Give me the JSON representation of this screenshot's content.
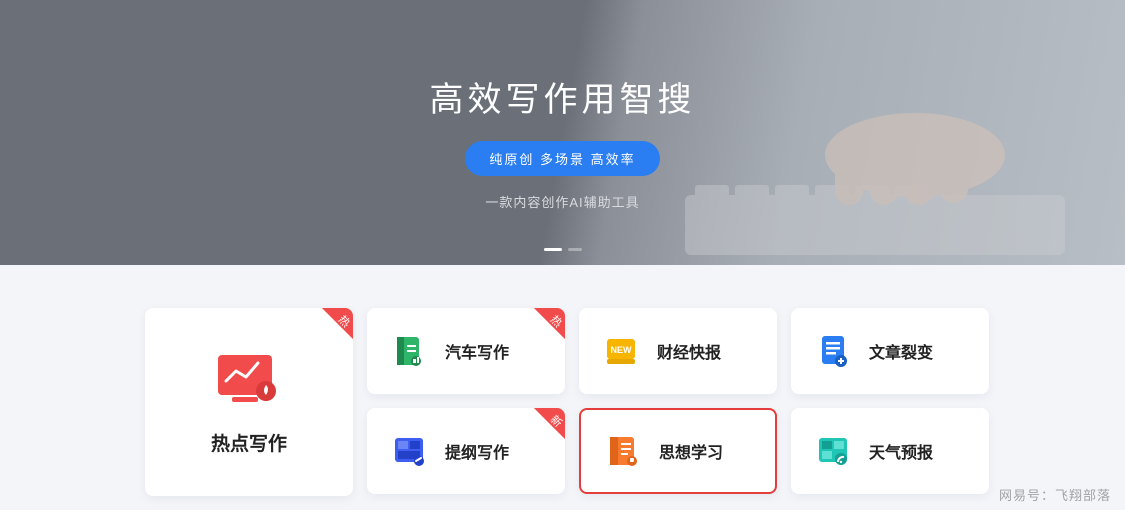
{
  "hero": {
    "title": "高效写作用智搜",
    "pill": "纯原创 多场景 高效率",
    "subtitle": "一款内容创作AI辅助工具"
  },
  "badges": {
    "hot": "热",
    "new": "新"
  },
  "cards": {
    "big": {
      "label": "热点写作",
      "badge": "hot",
      "icon": "chart-icon",
      "color": "#f24b4b"
    },
    "grid": [
      {
        "label": "汽车写作",
        "badge": "hot",
        "icon": "book-icon",
        "color": "#2fb56a"
      },
      {
        "label": "财经快报",
        "badge": null,
        "icon": "new-tag-icon",
        "color": "#f7b500"
      },
      {
        "label": "文章裂变",
        "badge": null,
        "icon": "document-icon",
        "color": "#2a7ef1"
      },
      {
        "label": "提纲写作",
        "badge": "new",
        "icon": "layout-icon",
        "color": "#3d5ef0"
      },
      {
        "label": "思想学习",
        "badge": null,
        "icon": "notebook-icon",
        "color": "#f77a2e",
        "highlight": true
      },
      {
        "label": "天气预报",
        "badge": null,
        "icon": "dashboard-icon",
        "color": "#1fc5b5"
      }
    ]
  },
  "watermark": "网易号：飞翔部落"
}
